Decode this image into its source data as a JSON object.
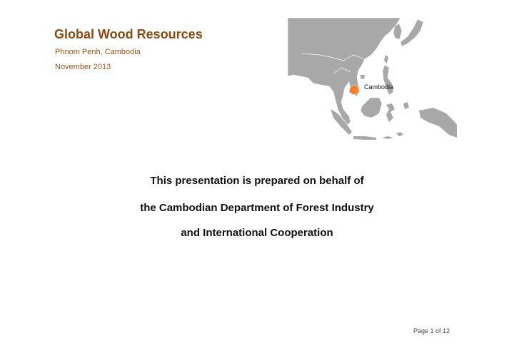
{
  "header": {
    "title": "Global Wood Resources",
    "location": "Phnom Penh, Cambodia",
    "date": "November 2013"
  },
  "map": {
    "highlight_label": "Cambodia",
    "land_color": "#a8a8a8",
    "highlight_color": "#f07f2a"
  },
  "body": {
    "line1": "This presentation is prepared on behalf of",
    "line2": "the Cambodian Department of Forest Industry",
    "line3": "and International Cooperation"
  },
  "footer": {
    "page_label": "Page 1 of 12"
  },
  "colors": {
    "title": "#8b4a12",
    "subtitle": "#9a5412"
  }
}
